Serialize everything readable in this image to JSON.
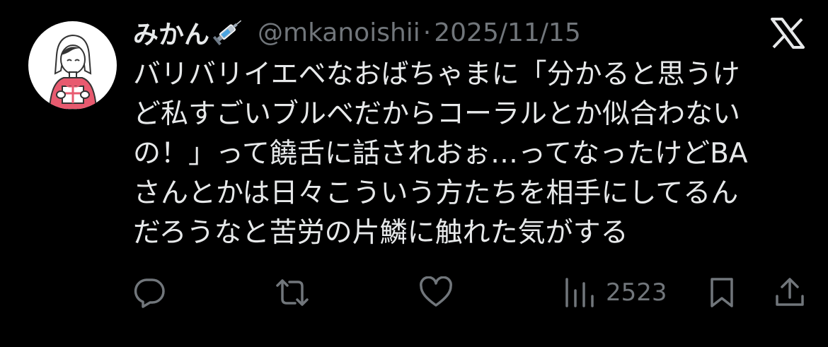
{
  "tweet": {
    "display_name": "みかん",
    "handle": "@mkanoishii",
    "separator": "·",
    "date": "2025/11/15",
    "body_lines": [
      "バリバリイエベなおばちゃまに「分かると思うけ",
      "ど私すごいブルベだからコーラルとか似合わない",
      "の！」って饒舌に話されおぉ…ってなったけどBA",
      "さんとかは日々こういう方たちを相手にしてるん",
      "だろうなと苦労の片鱗に触れた気がする"
    ]
  },
  "actions": {
    "views": "2523"
  },
  "icons": {
    "name_emoji": "syringe-icon",
    "logo": "x-logo-icon",
    "reply": "reply-icon",
    "retweet": "retweet-icon",
    "like": "heart-icon",
    "views": "views-icon",
    "bookmark": "bookmark-icon",
    "share": "share-icon"
  },
  "colors": {
    "background": "#000000",
    "primary_text": "#e7e9ea",
    "secondary_text": "#71767b",
    "avatar_sweater": "#e85a6f"
  }
}
